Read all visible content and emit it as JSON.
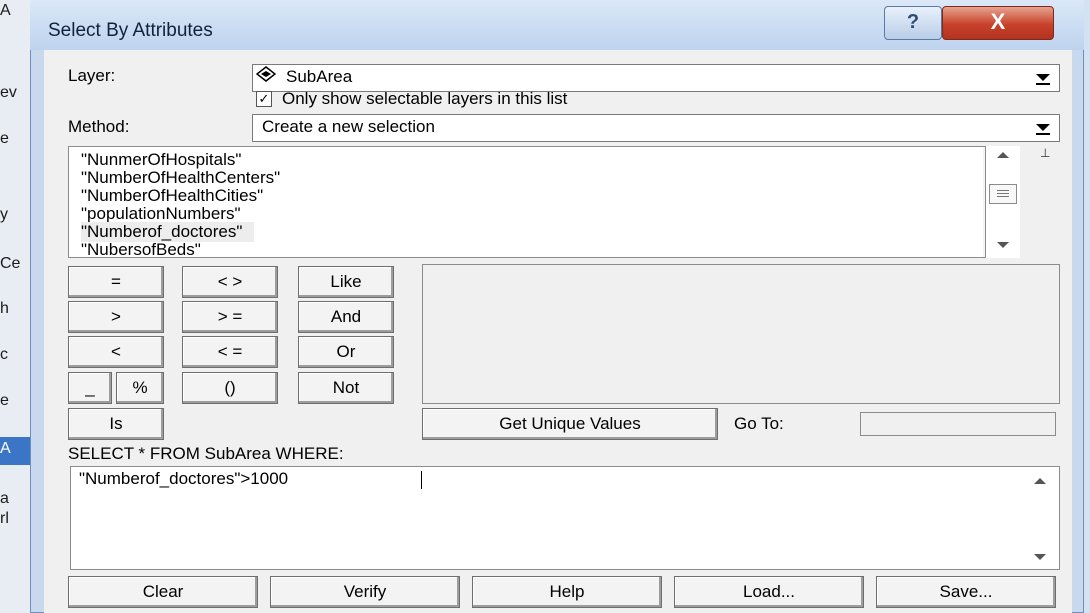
{
  "window": {
    "title": "Select By Attributes",
    "help_glyph": "?",
    "close_glyph": "X"
  },
  "background_chars": [
    "A",
    "ev",
    "e",
    "y",
    "Ce",
    "h",
    "c",
    "e",
    "A",
    "a",
    "rl"
  ],
  "layer": {
    "label": "Layer:",
    "value": "SubArea",
    "icon": "layer-diamond-icon",
    "only_selectable_checked": true,
    "only_selectable_label": "Only show selectable layers in this list"
  },
  "method": {
    "label": "Method:",
    "value": "Create a new selection"
  },
  "fields": [
    "\"NunmerOfHospitals\"",
    "\"NumberOfHealthCenters\"",
    "\"NumberOfHealthCities\"",
    "\"populationNumbers\"",
    "\"Numberof_doctores\"",
    "\"NubersofBeds\""
  ],
  "fields_highlighted_index": 4,
  "operators": {
    "eq": "=",
    "ne": "< >",
    "like": "Like",
    "gt": ">",
    "ge": "> =",
    "and": "And",
    "lt": "<",
    "le": "< =",
    "or": "Or",
    "underscore": "_",
    "percent": "%",
    "parens": "()",
    "not": "Not",
    "is": "Is"
  },
  "get_unique_values": "Get Unique Values",
  "go_to_label": "Go To:",
  "go_to_value": "",
  "sql_prefix": "SELECT * FROM SubArea WHERE:",
  "expression": "\"Numberof_doctores\">1000",
  "buttons": {
    "clear": "Clear",
    "verify": "Verify",
    "help": "Help",
    "load": "Load...",
    "save": "Save..."
  }
}
